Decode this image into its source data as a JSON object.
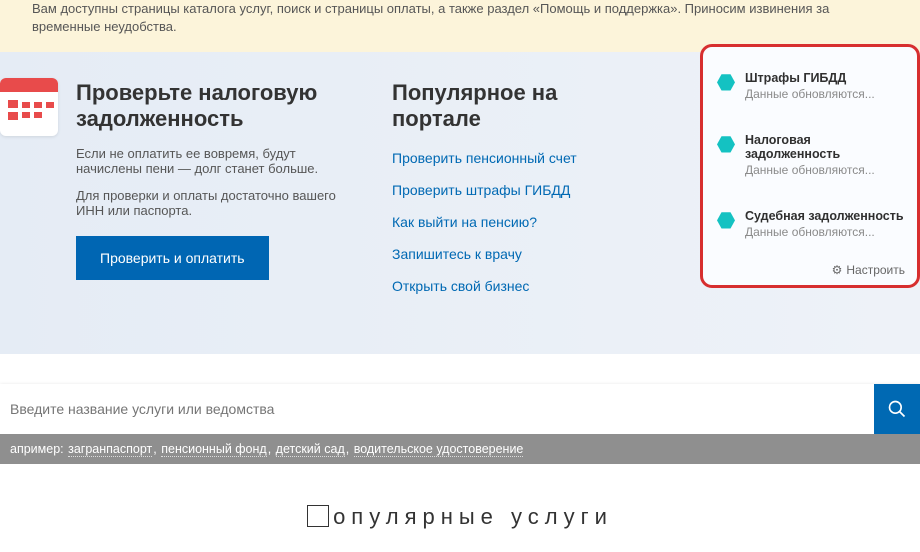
{
  "alert": {
    "text": "Вам доступны страницы каталога услуг, поиск и страницы оплаты, а также раздел «Помощь и поддержка». Приносим извинения за временные неудобства."
  },
  "check": {
    "title": "Проверьте налоговую задолженность",
    "p1": "Если не оплатить ее вовремя, будут начислены пени — долг станет больше.",
    "p2": "Для проверки и оплаты достаточно вашего ИНН или паспорта.",
    "button": "Проверить и оплатить"
  },
  "popular": {
    "title": "Популярное на портале",
    "links": [
      "Проверить пенсионный счет",
      "Проверить штрафы ГИБДД",
      "Как выйти на пенсию?",
      "Запишитесь к врачу",
      "Открыть свой бизнес"
    ]
  },
  "notif": {
    "items": [
      {
        "title": "Штрафы ГИБДД",
        "sub": "Данные обновляются..."
      },
      {
        "title": "Налоговая задолженность",
        "sub": "Данные обновляются..."
      },
      {
        "title": "Судебная задолженность",
        "sub": "Данные обновляются..."
      }
    ],
    "settings": "Настроить"
  },
  "search": {
    "placeholder": "Введите название услуги или ведомства"
  },
  "hints": {
    "prefix": "апример: ",
    "items": [
      "загранпаспорт",
      "пенсионный фонд",
      "детский сад",
      "водительское удостоверение"
    ]
  },
  "section_title": "опулярные услуги"
}
